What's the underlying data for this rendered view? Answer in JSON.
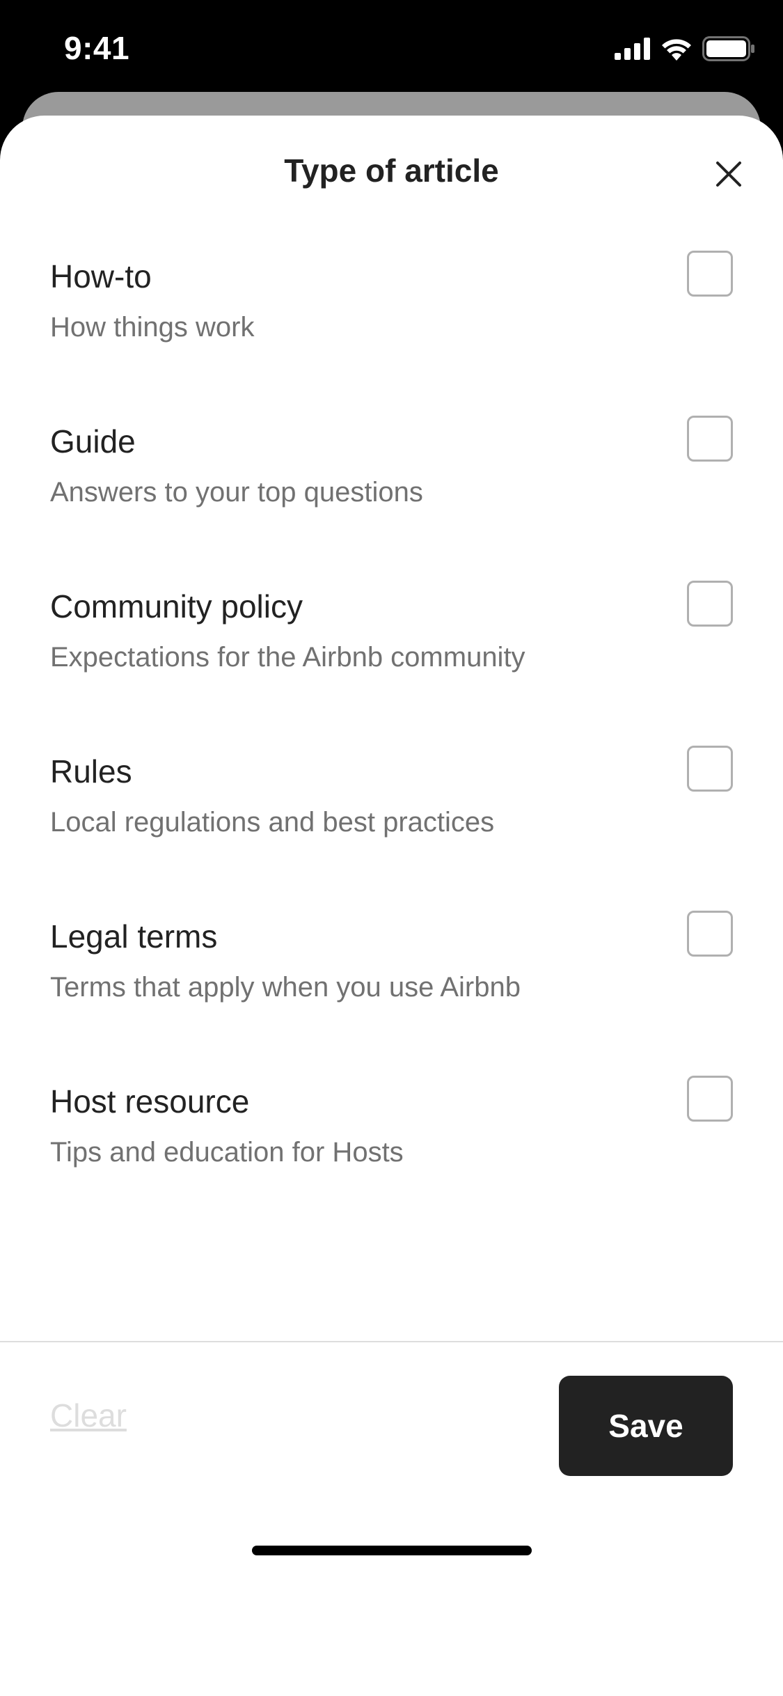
{
  "status_bar": {
    "time": "9:41",
    "icons": [
      "cellular-signal-icon",
      "wifi-icon",
      "battery-icon"
    ]
  },
  "sheet": {
    "title": "Type of article",
    "close_icon": "close-icon"
  },
  "options": [
    {
      "title": "How-to",
      "subtitle": "How things work",
      "checked": false
    },
    {
      "title": "Guide",
      "subtitle": "Answers to your top questions",
      "checked": false
    },
    {
      "title": "Community policy",
      "subtitle": "Expectations for the Airbnb community",
      "checked": false
    },
    {
      "title": "Rules",
      "subtitle": "Local regulations and best practices",
      "checked": false
    },
    {
      "title": "Legal terms",
      "subtitle": "Terms that apply when you use Airbnb",
      "checked": false
    },
    {
      "title": "Host resource",
      "subtitle": "Tips and education for Hosts",
      "checked": false
    }
  ],
  "footer": {
    "clear_label": "Clear",
    "save_label": "Save"
  },
  "colors": {
    "primary_text": "#222222",
    "secondary_text": "#717171",
    "disabled_text": "#DDDDDD",
    "button_bg": "#222222",
    "checkbox_border": "#B0B0B0"
  }
}
